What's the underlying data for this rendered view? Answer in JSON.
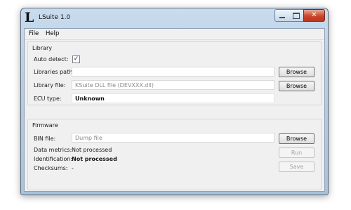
{
  "window": {
    "title": "LSuite 1.0",
    "logo_glyph": "L",
    "close_glyph": "✕"
  },
  "menu": {
    "items": [
      "File",
      "Help"
    ]
  },
  "library": {
    "title": "Library",
    "auto_detect_label": "Auto detect:",
    "auto_detect_checked": true,
    "check_glyph": "✓",
    "libraries_path_label": "Libraries path:",
    "libraries_path_value": "",
    "library_file_label": "Library file:",
    "library_file_value": "KSuite DLL file (DEVXXX.dll)",
    "ecu_type_label": "ECU type:",
    "ecu_type_value": "Unknown",
    "browse_label": "Browse"
  },
  "firmware": {
    "title": "Firmware",
    "bin_file_label": "BIN file:",
    "bin_file_value": "Dump file",
    "data_metrics_label": "Data metrics:",
    "data_metrics_value": "Not processed",
    "identification_label": "Identification:",
    "identification_value": "Not processed",
    "checksums_label": "Checksums:",
    "checksums_value": "-",
    "browse_label": "Browse",
    "run_label": "Run",
    "save_label": "Save"
  }
}
